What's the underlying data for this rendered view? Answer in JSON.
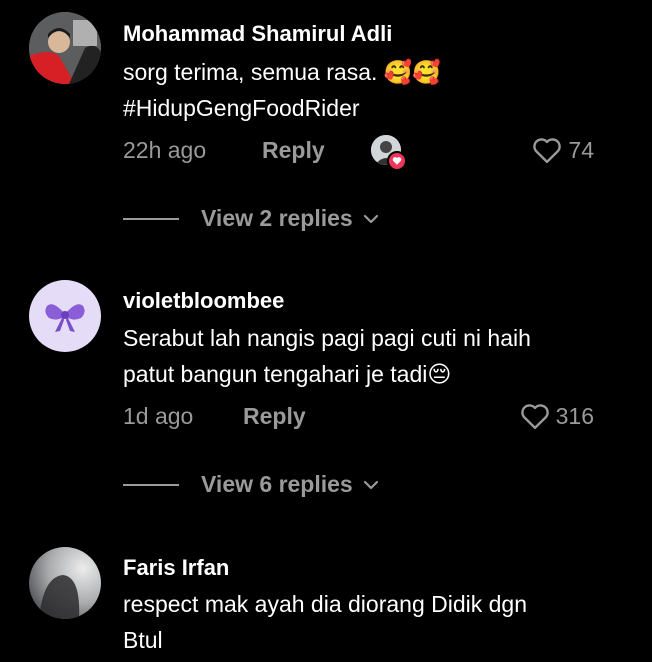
{
  "comments": [
    {
      "author": "Mohammad Shamirul Adli",
      "text_line1": "sorg terima, semua rasa. 🥰🥰",
      "text_line2": "#HidupGengFoodRider",
      "time": "22h ago",
      "reply_label": "Reply",
      "likes": "74",
      "view_replies": "View 2 replies"
    },
    {
      "author": "violetbloombee",
      "text_line1": "Serabut lah nangis pagi pagi cuti ni haih",
      "text_line2": "patut bangun tengahari je tadi😔",
      "time": "1d ago",
      "reply_label": "Reply",
      "likes": "316",
      "view_replies": "View 6 replies"
    },
    {
      "author": "Faris Irfan",
      "text_line1": "respect mak ayah dia diorang Didik dgn",
      "text_line2": "Btul"
    }
  ],
  "icons": {
    "like": "heart-outline-icon",
    "expand": "chevron-down-icon",
    "creator_liked": "heart-badge-icon",
    "bow": "purple-bow-emoji"
  },
  "colors": {
    "background": "#000000",
    "muted": "#9a9a9a",
    "violet_avatar_bg": "#e5dcf7",
    "creator_heart": "#f0345c"
  }
}
